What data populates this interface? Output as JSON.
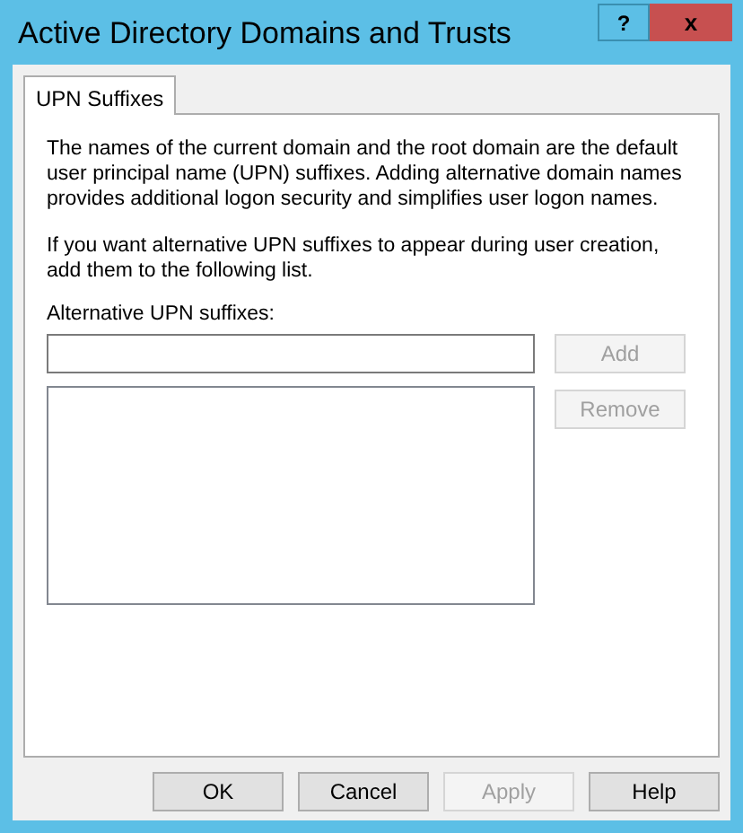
{
  "window": {
    "title": "Active Directory Domains and Trusts",
    "help_glyph": "?",
    "close_glyph": "x"
  },
  "tabs": [
    {
      "label": "UPN Suffixes",
      "selected": true
    }
  ],
  "paragraphs": [
    "The names of the current domain and the root domain are the default user principal name (UPN) suffixes. Adding alternative domain names provides additional logon security and simplifies user logon names.",
    "If you want alternative UPN suffixes to appear during user creation, add them to the following list."
  ],
  "suffix_field": {
    "label": "Alternative UPN suffixes:"
  },
  "side_buttons": [
    {
      "label": "Add",
      "disabled": true
    },
    {
      "label": "Remove",
      "disabled": true
    }
  ],
  "buttons": [
    {
      "label": "OK",
      "disabled": false
    },
    {
      "label": "Cancel",
      "disabled": false
    },
    {
      "label": "Apply",
      "disabled": true
    },
    {
      "label": "Help",
      "disabled": false
    }
  ]
}
